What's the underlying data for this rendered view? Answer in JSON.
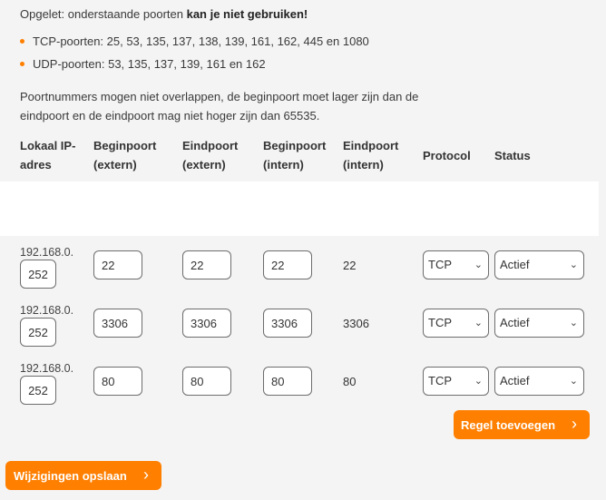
{
  "warning": {
    "prefix": "Opgelet: onderstaande poorten ",
    "bold": "kan je niet gebruiken!"
  },
  "blocked_ports": [
    "TCP-poorten: 25, 53, 135, 137, 138, 139, 161, 162, 445 en 1080",
    "UDP-poorten: 53, 135, 137, 139, 161 en 162"
  ],
  "note": "Poortnummers mogen niet overlappen, de beginpoort moet lager zijn dan de eindpoort en de eindpoort mag niet hoger zijn dan 65535.",
  "headers": {
    "ip": "Lokaal IP-adres",
    "start_ext": "Beginpoort (extern)",
    "end_ext": "Eindpoort (extern)",
    "start_int": "Beginpoort (intern)",
    "end_int": "Eindpoort (intern)",
    "protocol": "Protocol",
    "status": "Status"
  },
  "rules": [
    {
      "ip_prefix": "192.168.0.",
      "ip_last": "252",
      "start_ext": "22",
      "end_ext": "22",
      "start_int": "22",
      "end_int": "22",
      "protocol": "TCP",
      "status": "Actief"
    },
    {
      "ip_prefix": "192.168.0.",
      "ip_last": "252",
      "start_ext": "3306",
      "end_ext": "3306",
      "start_int": "3306",
      "end_int": "3306",
      "protocol": "TCP",
      "status": "Actief"
    },
    {
      "ip_prefix": "192.168.0.",
      "ip_last": "252",
      "start_ext": "80",
      "end_ext": "80",
      "start_int": "80",
      "end_int": "80",
      "protocol": "TCP",
      "status": "Actief"
    }
  ],
  "buttons": {
    "add_rule": "Regel toevoegen",
    "save": "Wijzigingen opslaan"
  },
  "colors": {
    "accent": "#ff7f00"
  },
  "icons": {
    "select": "chevron-down-icon",
    "button": "chevron-right-icon"
  }
}
